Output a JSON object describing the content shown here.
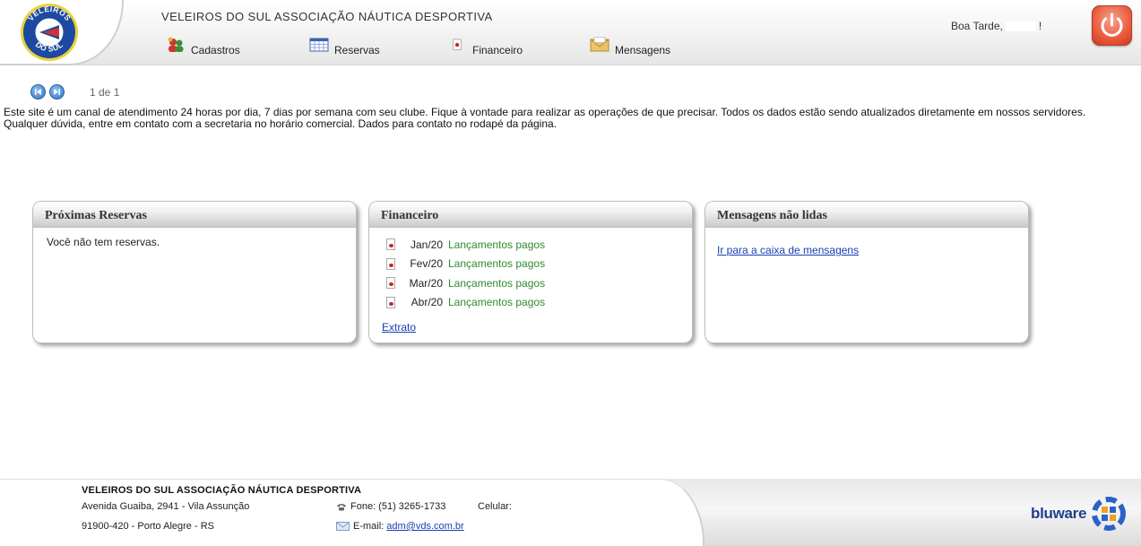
{
  "header": {
    "logo": {
      "top_text": "VELEIROS",
      "bottom_text": "DO SUL"
    },
    "title": "VELEIROS DO SUL ASSOCIAÇÃO NÁUTICA DESPORTIVA",
    "nav": [
      {
        "label": "Cadastros",
        "icon": "people-icon"
      },
      {
        "label": "Reservas",
        "icon": "calendar-grid-icon"
      },
      {
        "label": "Financeiro",
        "icon": "document-icon"
      },
      {
        "label": "Mensagens",
        "icon": "envelope-icon"
      }
    ],
    "greeting_prefix": "Boa Tarde,",
    "greeting_suffix": "!",
    "logout_icon": "power-icon"
  },
  "pager": {
    "count": "1 de 1"
  },
  "intro": {
    "line1": "Este site é um canal de atendimento 24 horas por dia, 7 dias por semana com seu clube. Fique à vontade para realizar as operações de que precisar. Todos os dados estão sendo atualizados diretamente em nossos servidores.",
    "line2": "Qualquer dúvida, entre em contato com a secretaria no horário comercial. Dados para contato no rodapé da página."
  },
  "panels": {
    "reservas": {
      "title": "Próximas Reservas",
      "empty": "Você não tem reservas."
    },
    "financeiro": {
      "title": "Financeiro",
      "rows": [
        {
          "month": "Jan/20",
          "status": "Lançamentos pagos"
        },
        {
          "month": "Fev/20",
          "status": "Lançamentos pagos"
        },
        {
          "month": "Mar/20",
          "status": "Lançamentos pagos"
        },
        {
          "month": "Abr/20",
          "status": "Lançamentos pagos"
        }
      ],
      "link": "Extrato"
    },
    "mensagens": {
      "title": "Mensagens não lidas",
      "link": "Ir para a caixa de mensagens"
    }
  },
  "footer": {
    "org": "VELEIROS DO SUL ASSOCIAÇÃO NÁUTICA DESPORTIVA",
    "address": "Avenida Guaiba, 2941 - Vila Assunção",
    "city": "91900-420 - Porto Alegre - RS",
    "phone": "Fone: (51) 3265-1733",
    "cel": "Celular:",
    "email_label": "E-mail:",
    "email": "adm@vds.com.br",
    "brand": "bluware"
  },
  "colors": {
    "accent_blue": "#1a3fb0",
    "paid_green": "#2d8a2d",
    "power_red": "#e95a3d",
    "brand_blue": "#1f3f8e"
  }
}
